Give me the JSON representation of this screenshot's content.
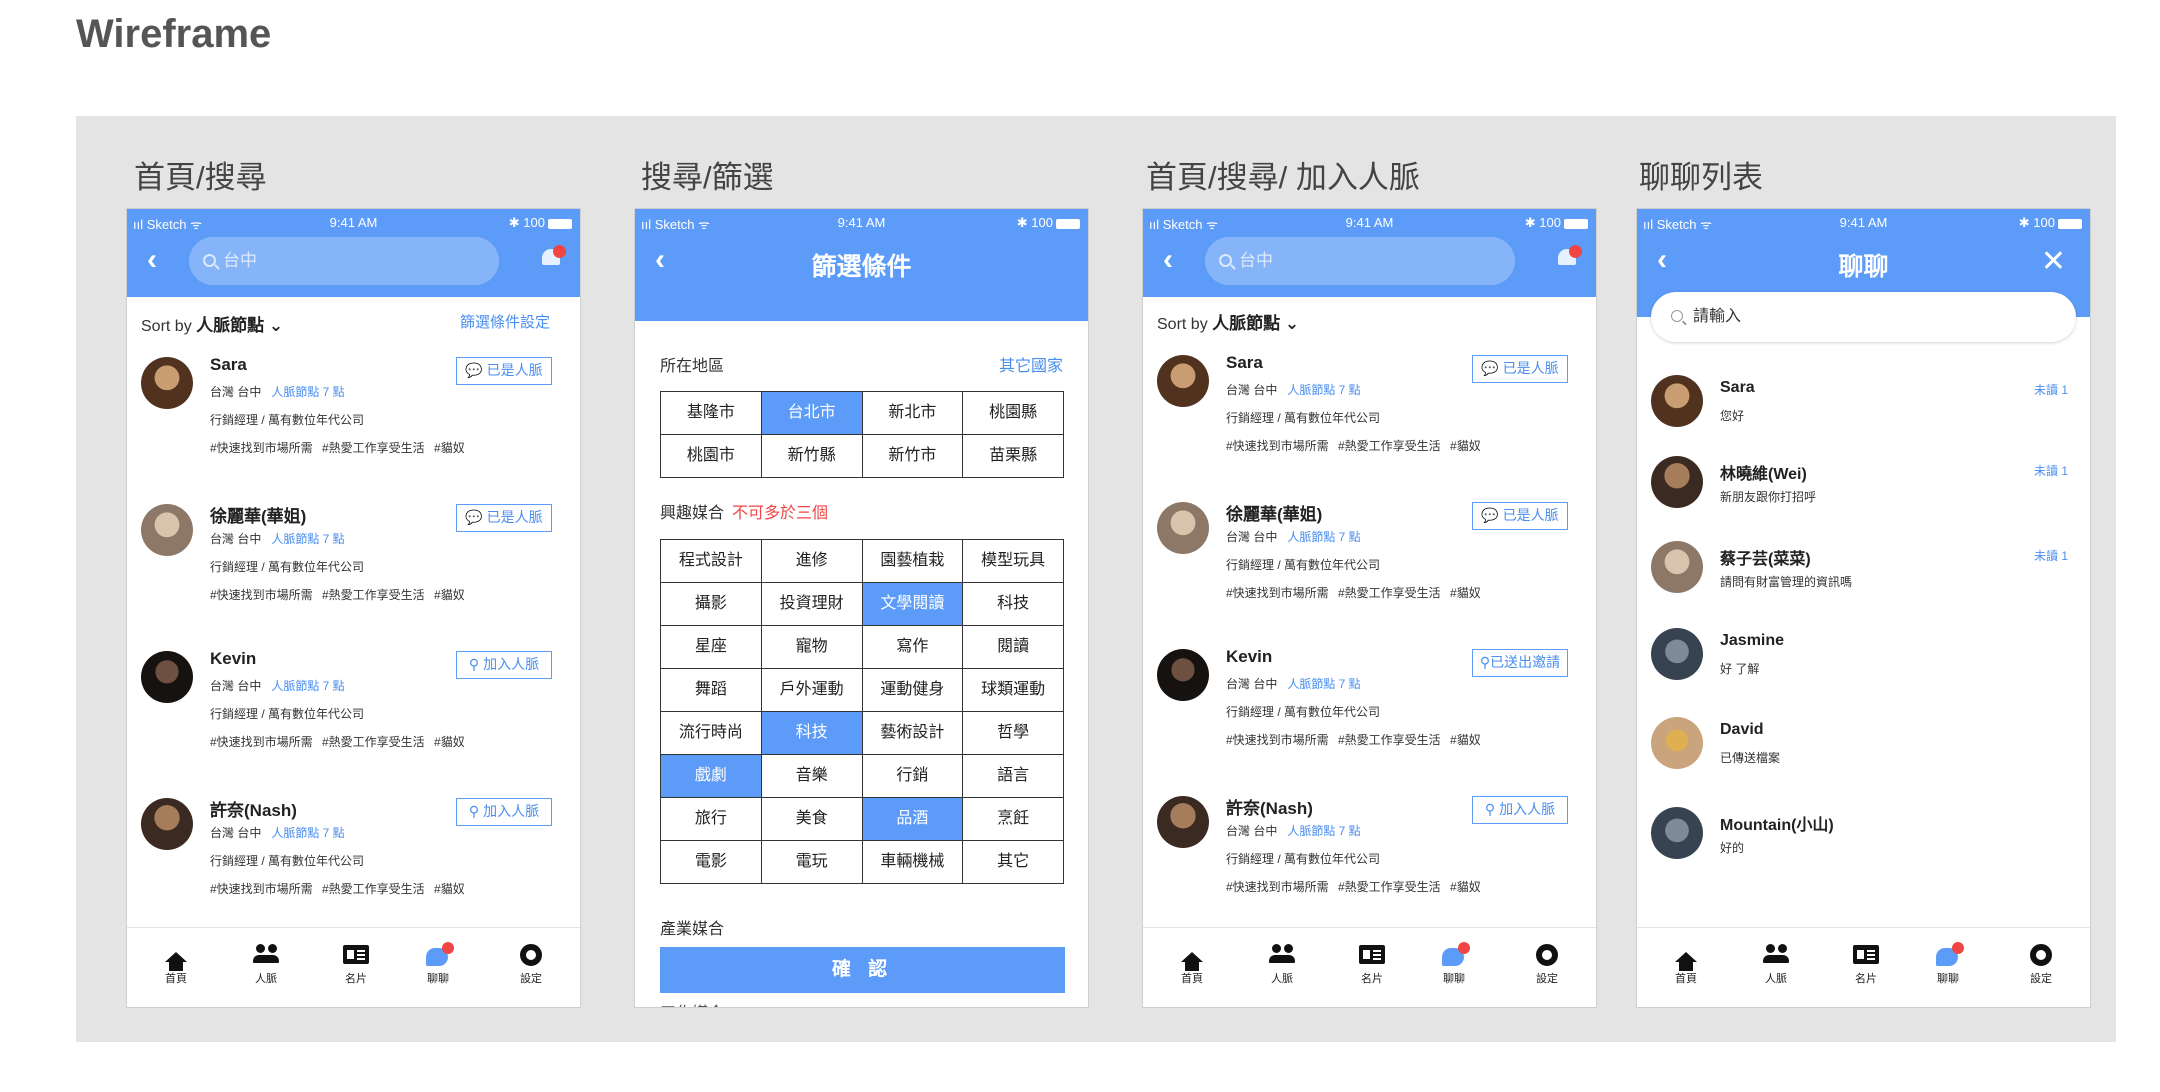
{
  "page_title": "Wireframe",
  "colors": {
    "accent": "#5c9bf7",
    "link": "#4a8ef0",
    "alert": "#f04545",
    "board": "#e4e4e4"
  },
  "status": {
    "signal": "ııl Sketch ᯤ",
    "time": "9:41 AM",
    "battery": "✱ 100"
  },
  "columns": [
    {
      "title": "首頁/搜尋"
    },
    {
      "title": "搜尋/篩選"
    },
    {
      "title": "首頁/搜尋/ 加入人脈"
    },
    {
      "title": "聊聊列表"
    }
  ],
  "home": {
    "search_value": "台中",
    "sort_label": "Sort by",
    "sort_value": "人脈節點 ⌄",
    "filter_link": "篩選條件設定"
  },
  "contacts_a": [
    {
      "name": "Sara",
      "loc": "台灣 台中",
      "nodes": "人脈節點 7 點",
      "job": "行銷經理 / 萬有數位年代公司",
      "tags": "#快速找到市場所需 #熱愛工作享受生活 #貓奴",
      "button": "💬 已是人脈"
    },
    {
      "name": "徐麗華(華姐)",
      "loc": "台灣 台中",
      "nodes": "人脈節點 7 點",
      "job": "行銷經理 / 萬有數位年代公司",
      "tags": "#快速找到市場所需 #熱愛工作享受生活 #貓奴",
      "button": "💬 已是人脈"
    },
    {
      "name": "Kevin",
      "loc": "台灣 台中",
      "nodes": "人脈節點 7 點",
      "job": "行銷經理 / 萬有數位年代公司",
      "tags": "#快速找到市場所需 #熱愛工作享受生活 #貓奴",
      "button": "⚲ 加入人脈"
    },
    {
      "name": "許奈(Nash)",
      "loc": "台灣 台中",
      "nodes": "人脈節點 7 點",
      "job": "行銷經理 / 萬有數位年代公司",
      "tags": "#快速找到市場所需 #熱愛工作享受生活 #貓奴",
      "button": "⚲ 加入人脈"
    }
  ],
  "contacts_c_buttons": [
    "💬 已是人脈",
    "💬 已是人脈",
    "⚲已送出邀請",
    "⚲ 加入人脈"
  ],
  "tabbar": [
    {
      "label": "首頁",
      "icon": "home-icon"
    },
    {
      "label": "人脈",
      "icon": "people-icon"
    },
    {
      "label": "名片",
      "icon": "card-icon"
    },
    {
      "label": "聊聊",
      "icon": "chat-icon"
    },
    {
      "label": "設定",
      "icon": "gear-icon"
    }
  ],
  "filter": {
    "title": "篩選條件",
    "region_label": "所在地區",
    "other_country": "其它國家",
    "regions": [
      "基隆市",
      "台北市",
      "新北市",
      "桃園縣",
      "桃園市",
      "新竹縣",
      "新竹市",
      "苗栗縣"
    ],
    "regions_selected": [
      "台北市"
    ],
    "interest_label": "興趣媒合",
    "interest_warning": "不可多於三個",
    "interests": [
      "程式設計",
      "進修",
      "園藝植栽",
      "模型玩具",
      "攝影",
      "投資理財",
      "文學閱讀",
      "科技",
      "星座",
      "寵物",
      "寫作",
      "閱讀",
      "舞蹈",
      "戶外運動",
      "運動健身",
      "球類運動",
      "流行時尚",
      "科技",
      "藝術設計",
      "哲學",
      "戲劇",
      "音樂",
      "行銷",
      "語言",
      "旅行",
      "美食",
      "品酒",
      "烹飪",
      "電影",
      "電玩",
      "車輛機械",
      "其它"
    ],
    "interests_selected_index": [
      6,
      17,
      20,
      26
    ],
    "industry_label": "產業媒合",
    "confirm": "確 認",
    "work_label": "工作媒合"
  },
  "chat": {
    "title": "聊聊",
    "search_placeholder": "請輸入",
    "rows": [
      {
        "name": "Sara",
        "msg": "您好",
        "unread": "未讀 1"
      },
      {
        "name": "林曉維(Wei)",
        "msg": "新朋友跟你打招呼",
        "unread": "未讀 1"
      },
      {
        "name": "蔡子芸(菜菜)",
        "msg": "請問有財富管理的資訊嗎",
        "unread": "未讀 1"
      },
      {
        "name": "Jasmine",
        "msg": "好 了解",
        "unread": ""
      },
      {
        "name": "David",
        "msg": "已傳送檔案",
        "unread": ""
      },
      {
        "name": "Mountain(小山)",
        "msg": "好的",
        "unread": ""
      }
    ]
  }
}
